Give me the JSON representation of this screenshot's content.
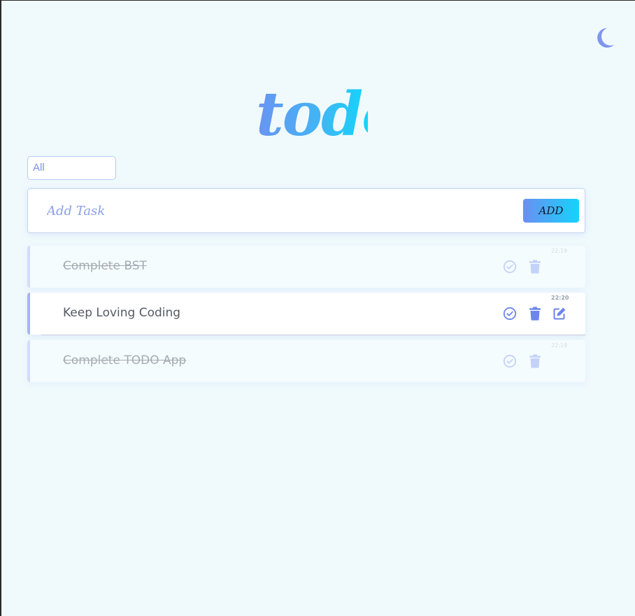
{
  "app": {
    "logo_text": "todo"
  },
  "header": {
    "theme_toggle_icon": "moon-icon"
  },
  "filter": {
    "selected": "All"
  },
  "add_task": {
    "placeholder": "Add Task",
    "value": "",
    "button_label": "ADD"
  },
  "tasks": [
    {
      "text": "Complete BST",
      "time": "22:19",
      "completed": true
    },
    {
      "text": "Keep Loving Coding",
      "time": "22:20",
      "completed": false
    },
    {
      "text": "Complete TODO App",
      "time": "22:19",
      "completed": true
    }
  ],
  "colors": {
    "accent": "#6b8ff2",
    "accent_end": "#14d3fb",
    "background": "#f0fafd",
    "icon": "#6c86ea",
    "icon_faded": "#c4d2fa"
  }
}
